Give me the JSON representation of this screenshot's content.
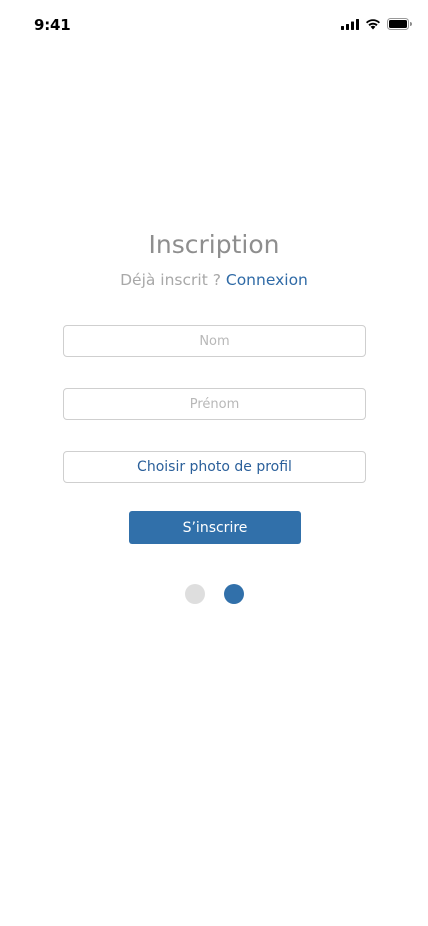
{
  "status_bar": {
    "time": "9:41"
  },
  "header": {
    "title": "Inscription",
    "already_registered": "Déjà inscrit ?",
    "login_link": "Connexion"
  },
  "form": {
    "nom_placeholder": "Nom",
    "prenom_placeholder": "Prénom",
    "photo_button_label": "Choisir photo de profil",
    "submit_label": "S’inscrire"
  },
  "pagination": {
    "total_pages": 2,
    "active_page": 2
  },
  "colors": {
    "accent": "#3170aa",
    "muted_text": "#a8a8a8",
    "title_text": "#8e8e8e",
    "inactive_dot": "#dedede"
  },
  "icons": [
    "cellular-signal-icon",
    "wifi-icon",
    "battery-icon"
  ]
}
